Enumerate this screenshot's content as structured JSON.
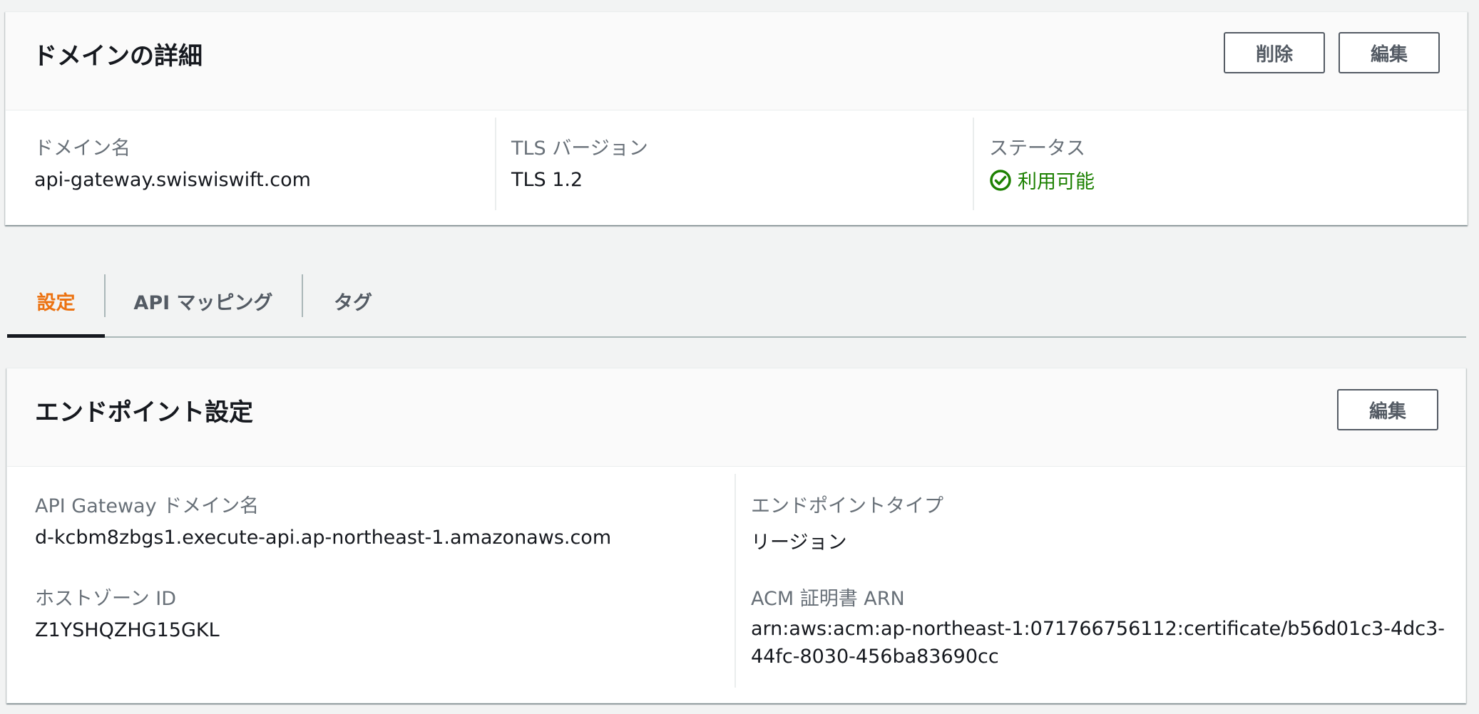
{
  "domain_details": {
    "title": "ドメインの詳細",
    "delete_label": "削除",
    "edit_label": "編集",
    "domain_name_label": "ドメイン名",
    "domain_name_value": "api-gateway.swiswiswift.com",
    "tls_label": "TLS バージョン",
    "tls_value": "TLS 1.2",
    "status_label": "ステータス",
    "status_value": "利用可能",
    "status_icon": "check-circle-icon",
    "status_color": "#1d8102"
  },
  "tabs": [
    {
      "label": "設定",
      "active": true
    },
    {
      "label": "API マッピング",
      "active": false
    },
    {
      "label": "タグ",
      "active": false
    }
  ],
  "endpoint_config": {
    "title": "エンドポイント設定",
    "edit_label": "編集",
    "apigw_domain_label": "API Gateway ドメイン名",
    "apigw_domain_value": "d-kcbm8zbgs1.execute-api.ap-northeast-1.amazonaws.com",
    "hosted_zone_label": "ホストゾーン ID",
    "hosted_zone_value": "Z1YSHQZHG15GKL",
    "endpoint_type_label": "エンドポイントタイプ",
    "endpoint_type_value": "リージョン",
    "acm_arn_label": "ACM 証明書 ARN",
    "acm_arn_value": "arn:aws:acm:ap-northeast-1:071766756112:certificate/b56d01c3-4dc3-44fc-8030-456ba83690cc"
  },
  "colors": {
    "accent_orange": "#ec7211",
    "success_green": "#1d8102",
    "page_bg": "#f2f3f3"
  }
}
